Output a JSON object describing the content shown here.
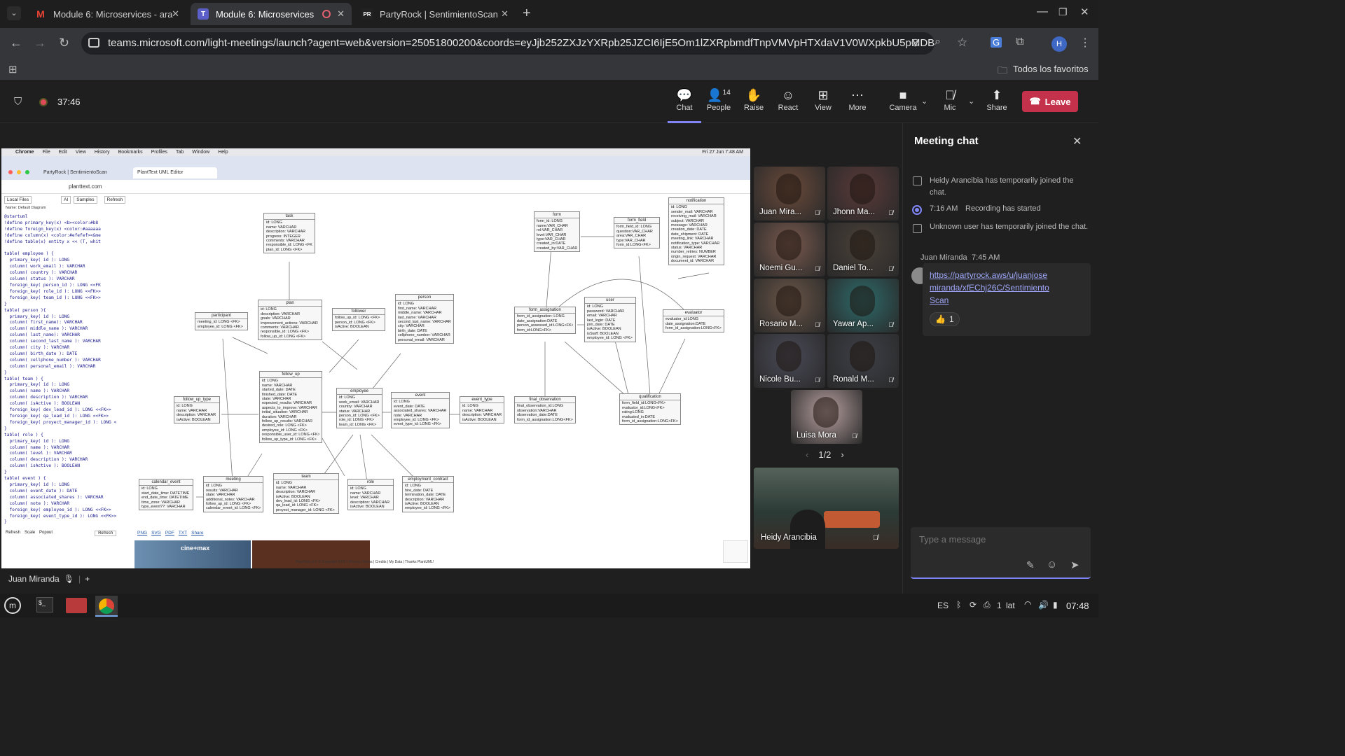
{
  "browser": {
    "tabs": [
      {
        "label": "Module 6: Microservices - ara",
        "favicon": "gmail-icon"
      },
      {
        "label": "Module 6: Microservices",
        "favicon": "teams-icon"
      },
      {
        "label": "PartyRock | SentimientoScan",
        "favicon": "partyrock-icon"
      }
    ],
    "url": "teams.microsoft.com/light-meetings/launch?agent=web&version=25051800200&coords=eyJjb252ZXJzYXRpb25JZCI6IjE5Om1lZXRpbmdfTnpVMVpHTXdaV1V0WXpkbU5pMDBNVFV...",
    "favorites_label": "Todos los favoritos",
    "profile_initial": "H"
  },
  "meeting": {
    "timer": "37:46",
    "toolbar": {
      "chat": "Chat",
      "people": "People",
      "people_count": "14",
      "raise": "Raise",
      "react": "React",
      "view": "View",
      "more": "More",
      "camera": "Camera",
      "mic": "Mic",
      "share": "Share",
      "leave": "Leave"
    }
  },
  "shared_screen": {
    "mac_menu": [
      "Chrome",
      "File",
      "Edit",
      "View",
      "History",
      "Bookmarks",
      "Profiles",
      "Tab",
      "Window",
      "Help"
    ],
    "mac_clock": "Fri 27 Jun 7:48 AM",
    "tabs": [
      "PartyRock | SentimientoScan",
      "PlantText UML Editor"
    ],
    "url": "planttext.com",
    "editor_buttons": [
      "Local Files",
      "AI",
      "Samples",
      "Refresh"
    ],
    "diagram_name": "Name: Default Diagram",
    "code": "@startuml\n!define primary_key(x) <b><color:#b8\n!define foreign_key(x) <color:#aaaaaa\n!define column(x) <color:#efefef><&me\n!define table(x) entity x << (T, whit\n\ntable( employee ) {\n  primary_key( id ): LONG\n  column( work_email ): VARCHAR\n  column( country ): VARCHAR\n  column( status ): VARCHAR\n  foreign_key( person_id ): LONG <<FK\n  foreign_key( role_id ): LONG <<FK>>\n  foreign_key( team_id ): LONG <<FK>>\n}\ntable( person ){\n  primary_key( id ): LONG\n  column( first_name): VARCHAR\n  column( middle_name ): VARCHAR\n  column( last_name): VARCHAR\n  column( second_last_name ): VARCHAR\n  column( city ): VARCHAR\n  column( birth_date ): DATE\n  column( cellphone_number ): VARCHAR\n  column( personal_email ): VARCHAR\n}\ntable( team ) {\n  primary_key( id ): LONG\n  column( name ): VARCHAR\n  column( description ): VARCHAR\n  column( isActive ): BOOLEAN\n  foreign_key( dev_lead_id ): LONG <<FK>>\n  foreign_key( qa_lead_id ): LONG <<FK>>\n  foreign_key( proyect_manager_id ): LONG <\n}\ntable( role ) {\n  primary_key( id ): LONG\n  column( name ): VARCHAR\n  column( level ): VARCHAR\n  column( description ): VARCHAR\n  column( isActive ): BOOLEAN\n}\ntable( event ) {\n  primary_key( id ): LONG\n  column( event_date ): DATE\n  column( associated_shares ): VARCHAR\n  column( note ): VARCHAR\n  foreign_key( employee_id ): LONG <<FK>>\n  foreign_key( event_type_id ): LONG <<FK>>\n}",
    "editor_options": [
      "Refresh",
      "Scale",
      "Popout"
    ],
    "export_links": [
      "PNG",
      "SVG",
      "PDF",
      "TXT",
      "Share"
    ],
    "copyright": "PlantText LLC © Copyright 2025 | Privacy | Terms | Credits | My Data | Thanks PlantUML!",
    "ad_text": "cine+max",
    "entities": [
      {
        "name": "task",
        "fields": [
          "id: LONG",
          "name: VARCHAR",
          "description: VARCHAR",
          "progress: INTEGER",
          "comments: VARCHAR",
          "responsible_id: LONG <FK>",
          "plan_id: LONG <FK>"
        ]
      },
      {
        "name": "participant",
        "fields": [
          "meeting_id: LONG <FK>",
          "employee_id: LONG <FK>"
        ]
      },
      {
        "name": "plan",
        "fields": [
          "id: LONG",
          "description: VARCHAR",
          "goals: VARCHAR",
          "improvement_actions: VARCHAR",
          "comments: VARCHAR",
          "responsible_id: LONG <FK>",
          "follow_up_id: LONG <FK>"
        ]
      },
      {
        "name": "follower",
        "fields": [
          "follow_up_id: LONG <FK>",
          "person_id: LONG <FK>",
          "isActive: BOOLEAN"
        ]
      },
      {
        "name": "person",
        "fields": [
          "id: LONG",
          "first_name: VARCHAR",
          "middle_name: VARCHAR",
          "last_name: VARCHAR",
          "second_last_name: VARCHAR",
          "city: VARCHAR",
          "birth_date: DATE",
          "cellphone_number: VARCHAR",
          "personal_email: VARCHAR"
        ]
      },
      {
        "name": "form",
        "fields": [
          "form_id: LONG",
          "name:VAR_CHAR",
          "rol:VAR_CHAR",
          "level:VAR_CHAR",
          "type:VAR_CHAR",
          "created_in:DATE",
          "created_by:VAR_CHAR"
        ]
      },
      {
        "name": "form_field",
        "fields": [
          "form_field_id: LONG",
          "question:VAR_CHAR",
          "area:VAR_CHAR",
          "type:VAR_CHAR",
          "form_id:LONG<FK>"
        ]
      },
      {
        "name": "notification",
        "fields": [
          "id: LONG",
          "sender_mail: VARCHAR",
          "receiving_mail: VARCHAR",
          "subject: VARCHAR",
          "message: VARCHAR",
          "creation_date: DATE",
          "date_shipment: DATE",
          "meeting_link: VARCHAR",
          "notification_type: VARCHAR",
          "status: VARCHAR",
          "number_retries: NUMBER",
          "origin_request: VARCHAR",
          "document_id: VARCHAR"
        ]
      },
      {
        "name": "form_assignation",
        "fields": [
          "form_id_assignation: LONG",
          "date_assignation:DATE",
          "person_assessed_id:LONG<FK>",
          "form_id:LONG<FK>"
        ]
      },
      {
        "name": "user",
        "fields": [
          "id: LONG",
          "password: VARCHAR",
          "email: VARCHAR",
          "last_login: DATE",
          "join_date: DATE",
          "isActive: BOOLEAN",
          "isStaff: BOOLEAN",
          "employee_id: LONG <FK>"
        ]
      },
      {
        "name": "evaluator",
        "fields": [
          "evaluator_id:LONG",
          "date_assignation:DATE",
          "form_id_assignation:LONG<FK>"
        ]
      },
      {
        "name": "follow_up",
        "fields": [
          "id: LONG",
          "name: VARCHAR",
          "started_date: DATE",
          "finished_date: DATE",
          "state: VARCHAR",
          "expected_results: VARCHAR",
          "aspects_to_improve: VARCHAR",
          "initial_situation: VARCHAR",
          "duration: VARCHAR",
          "follow_up_results: VARCHAR",
          "desired_role: LONG <FK>",
          "employee_id: LONG <FK>",
          "responsible_user_id: LONG <FK>",
          "follow_up_type_id: LONG <FK>"
        ]
      },
      {
        "name": "employee",
        "fields": [
          "id: LONG",
          "work_email: VARCHAR",
          "country: VARCHAR",
          "status: VARCHAR",
          "person_id: LONG <FK>",
          "role_id: LONG <FK>",
          "team_id: LONG <FK>"
        ]
      },
      {
        "name": "event",
        "fields": [
          "id: LONG",
          "event_date: DATE",
          "associated_shares: VARCHAR",
          "note: VARCHAR",
          "employee_id: LONG <FK>",
          "event_type_id: LONG <FK>"
        ]
      },
      {
        "name": "event_type",
        "fields": [
          "id: LONG",
          "name: VARCHAR",
          "description: VARCHAR",
          "isActive: BOOLEAN"
        ]
      },
      {
        "name": "follow_up_type",
        "fields": [
          "id: LONG",
          "name: VARCHAR",
          "description: VARCHAR",
          "isActive: BOOLEAN"
        ]
      },
      {
        "name": "final_observation",
        "fields": [
          "final_observation_id:LONG",
          "observation:VARCHAR",
          "observation_date:DATE",
          "form_id_assignation:LONG<FK>"
        ]
      },
      {
        "name": "qualification",
        "fields": [
          "form_field_id:LONG<FK>",
          "evaluator_id:LONG<FK>",
          "rating:LONG",
          "evaluated_in:DATE",
          "form_id_assignation:LONG<FK>"
        ]
      },
      {
        "name": "calendar_event",
        "fields": [
          "id: LONG",
          "start_date_time: DATETIME",
          "end_date_time: DATETIME",
          "time_zone: VARCHAR",
          "type_event??: VARCHAR"
        ]
      },
      {
        "name": "meeting",
        "fields": [
          "id: LONG",
          "results: VARCHAR",
          "state: VARCHAR",
          "additional_notes: VARCHAR",
          "follow_up_id: LONG <FK>",
          "calendar_event_id: LONG <FK>"
        ]
      },
      {
        "name": "team",
        "fields": [
          "id: LONG",
          "name: VARCHAR",
          "description: VARCHAR",
          "isActive: BOOLEAN",
          "dev_lead_id: LONG <FK>",
          "qa_lead_id: LONG <FK>",
          "proyect_manager_id: LONG <FK>"
        ]
      },
      {
        "name": "role",
        "fields": [
          "id: LONG",
          "name: VARCHAR",
          "level: VARCHAR",
          "description: VARCHAR",
          "isActive: BOOLEAN"
        ]
      },
      {
        "name": "employment_contract",
        "fields": [
          "id: LONG",
          "hire_date: DATE",
          "termination_date: DATE",
          "description: VARCHAR",
          "isActive: BOOLEAN",
          "employee_id: LONG <FK>"
        ]
      }
    ],
    "presenter": "Juan Miranda"
  },
  "participants": {
    "tiles": [
      {
        "name": "Juan Mira...",
        "color": "#6b4a3a"
      },
      {
        "name": "Jhonn Ma...",
        "color": "#5a3a38"
      },
      {
        "name": "Noemi Gu...",
        "color": "#7a5a4e"
      },
      {
        "name": "Daniel To...",
        "color": "#4a4038"
      },
      {
        "name": "Rosario M...",
        "color": "#6b5648"
      },
      {
        "name": "Yawar Ap...",
        "color": "#2d6a6a"
      },
      {
        "name": "Nicole Bu...",
        "color": "#4a4a58"
      },
      {
        "name": "Ronald M...",
        "color": "#3e4048"
      },
      {
        "name": "Luisa Mora",
        "color": "#b8a0a0"
      }
    ],
    "pager": "1/2",
    "featured": {
      "name": "Heidy Arancibia"
    }
  },
  "chat": {
    "title": "Meeting chat",
    "events": [
      {
        "text": "Heidy Arancibia has temporarily joined the chat."
      },
      {
        "time": "7:16 AM",
        "text": "Recording has started"
      },
      {
        "text": "Unknown user has temporarily joined the chat."
      }
    ],
    "message": {
      "author": "Juan Miranda",
      "time": "7:45 AM",
      "link": "https://partyrock.aws/u/juanjosemiranda/xfEChj26C/SentimientoScan",
      "reaction": "👍",
      "reaction_count": "1"
    },
    "input_placeholder": "Type a message"
  },
  "taskbar": {
    "lang": "ES",
    "kb": "lat",
    "battery": "1",
    "clock": "07:48"
  }
}
